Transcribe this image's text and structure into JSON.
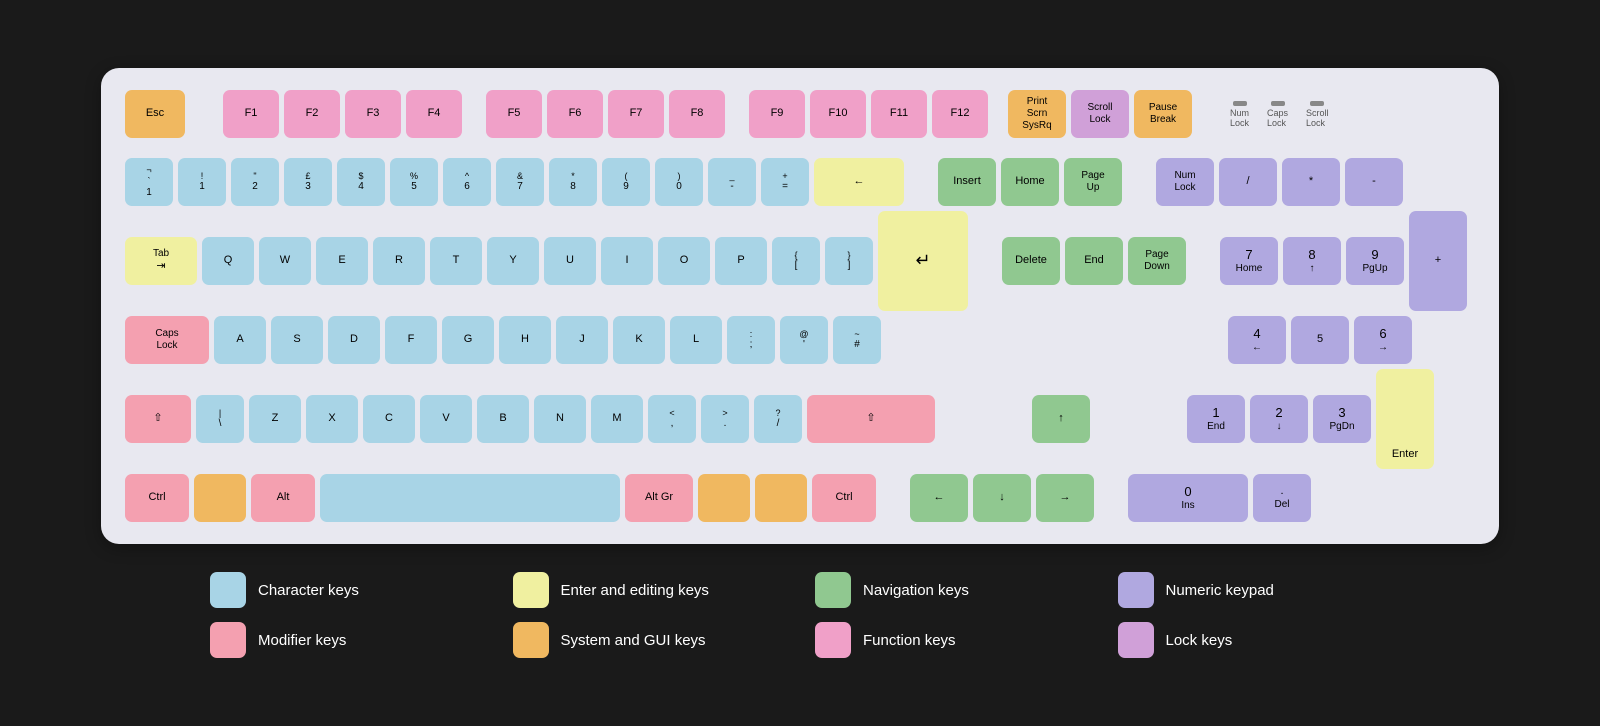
{
  "legend": [
    {
      "label": "Character keys",
      "color": "#a8d4e6"
    },
    {
      "label": "Enter and editing keys",
      "color": "#f0f0a0"
    },
    {
      "label": "Navigation keys",
      "color": "#90c890"
    },
    {
      "label": "Numeric keypad",
      "color": "#b0a8e0"
    },
    {
      "label": "Modifier keys",
      "color": "#f4a0b0"
    },
    {
      "label": "System and GUI keys",
      "color": "#f0b860"
    },
    {
      "label": "Function keys",
      "color": "#f0a0c8"
    },
    {
      "label": "Lock keys",
      "color": "#d0a0d8"
    }
  ]
}
